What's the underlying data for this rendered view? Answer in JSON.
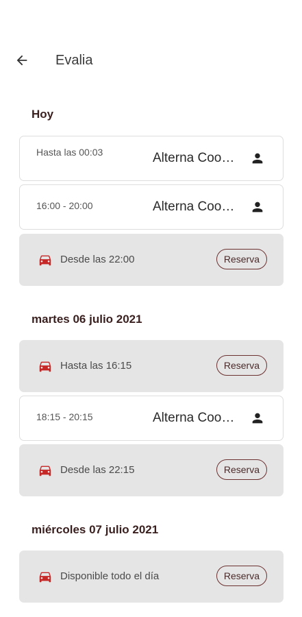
{
  "header": {
    "title": "Evalia"
  },
  "colors": {
    "accent": "#c62828",
    "free_card_bg": "#e5e5e5",
    "reserve_border": "#6b3030"
  },
  "days": [
    {
      "title": "Hoy",
      "slots": [
        {
          "type": "booked",
          "time": "Hasta las 00:03",
          "owner": "Alterna Cooperativa",
          "icon": "person-icon"
        },
        {
          "type": "booked",
          "time": "16:00 - 20:00",
          "owner": "Alterna Cooperativa",
          "icon": "person-icon"
        },
        {
          "type": "free",
          "label": "Desde las 22:00",
          "button": "Reserva",
          "icon": "car-icon"
        }
      ]
    },
    {
      "title": "martes 06 julio 2021",
      "slots": [
        {
          "type": "free",
          "label": "Hasta las 16:15",
          "button": "Reserva",
          "icon": "car-icon"
        },
        {
          "type": "booked",
          "time": "18:15 - 20:15",
          "owner": "Alterna Cooperativa",
          "icon": "person-icon"
        },
        {
          "type": "free",
          "label": "Desde las 22:15",
          "button": "Reserva",
          "icon": "car-icon"
        }
      ]
    },
    {
      "title": "miércoles 07 julio 2021",
      "slots": [
        {
          "type": "free",
          "label": "Disponible todo el día",
          "button": "Reserva",
          "icon": "car-icon"
        }
      ]
    }
  ]
}
